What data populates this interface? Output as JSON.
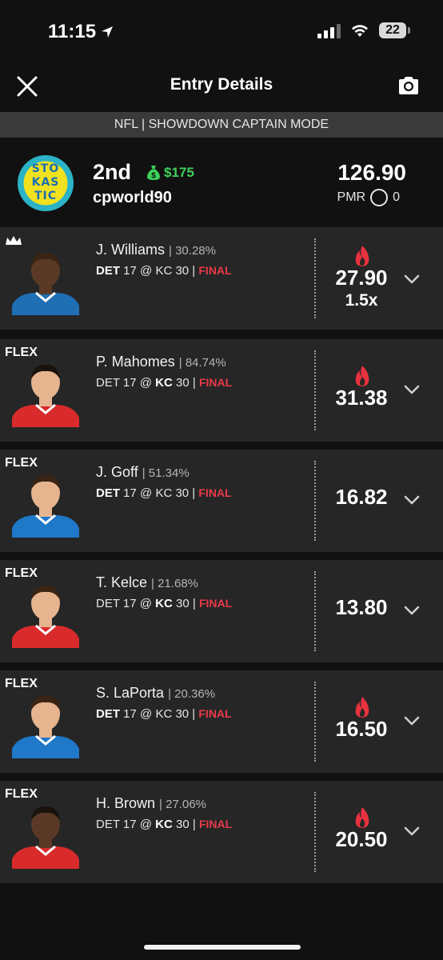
{
  "status_bar": {
    "time": "11:15",
    "battery": "22"
  },
  "nav": {
    "title": "Entry Details"
  },
  "mode_banner": "NFL | SHOWDOWN CAPTAIN MODE",
  "summary": {
    "logo_text": [
      "STO",
      "KAS",
      "TIC"
    ],
    "rank": "2nd",
    "prize": "$175",
    "username": "cpworld90",
    "total_score": "126.90",
    "pmr_label": "PMR",
    "pmr_value": "0"
  },
  "roster": [
    {
      "slot": "",
      "is_captain": true,
      "name": "J. Williams",
      "ownership": "30.28%",
      "team_away": "DET",
      "score_away": "17",
      "at": "@",
      "team_home": "KC",
      "score_home": "30",
      "bold_team": "DET",
      "status": "FINAL",
      "points": "27.90",
      "multiplier": "1.5x",
      "hot": true,
      "jersey": "#1f6fb5"
    },
    {
      "slot": "FLEX",
      "is_captain": false,
      "name": "P. Mahomes",
      "ownership": "84.74%",
      "team_away": "DET",
      "score_away": "17",
      "at": "@",
      "team_home": "KC",
      "score_home": "30",
      "bold_team": "KC",
      "status": "FINAL",
      "points": "31.38",
      "multiplier": "",
      "hot": true,
      "jersey": "#d92b2b"
    },
    {
      "slot": "FLEX",
      "is_captain": false,
      "name": "J. Goff",
      "ownership": "51.34%",
      "team_away": "DET",
      "score_away": "17",
      "at": "@",
      "team_home": "KC",
      "score_home": "30",
      "bold_team": "DET",
      "status": "FINAL",
      "points": "16.82",
      "multiplier": "",
      "hot": false,
      "jersey": "#1f78c8"
    },
    {
      "slot": "FLEX",
      "is_captain": false,
      "name": "T. Kelce",
      "ownership": "21.68%",
      "team_away": "DET",
      "score_away": "17",
      "at": "@",
      "team_home": "KC",
      "score_home": "30",
      "bold_team": "KC",
      "status": "FINAL",
      "points": "13.80",
      "multiplier": "",
      "hot": false,
      "jersey": "#d92b2b"
    },
    {
      "slot": "FLEX",
      "is_captain": false,
      "name": "S. LaPorta",
      "ownership": "20.36%",
      "team_away": "DET",
      "score_away": "17",
      "at": "@",
      "team_home": "KC",
      "score_home": "30",
      "bold_team": "DET",
      "status": "FINAL",
      "points": "16.50",
      "multiplier": "",
      "hot": true,
      "jersey": "#1f78c8"
    },
    {
      "slot": "FLEX",
      "is_captain": false,
      "name": "H. Brown",
      "ownership": "27.06%",
      "team_away": "DET",
      "score_away": "17",
      "at": "@",
      "team_home": "KC",
      "score_home": "30",
      "bold_team": "KC",
      "status": "FINAL",
      "points": "20.50",
      "multiplier": "",
      "hot": true,
      "jersey": "#d92b2b"
    }
  ],
  "colors": {
    "accent_green": "#3fd15a",
    "final_red": "#ea3a4a",
    "flame_red": "#e8323e",
    "card_bg": "#262626"
  },
  "icons": {
    "close": "close-icon",
    "camera": "camera-icon",
    "location": "location-arrow-icon",
    "wifi": "wifi-icon",
    "money_bag": "money-bag-icon",
    "crown": "crown-icon",
    "flame": "flame-icon",
    "chevron": "chevron-down-icon"
  }
}
